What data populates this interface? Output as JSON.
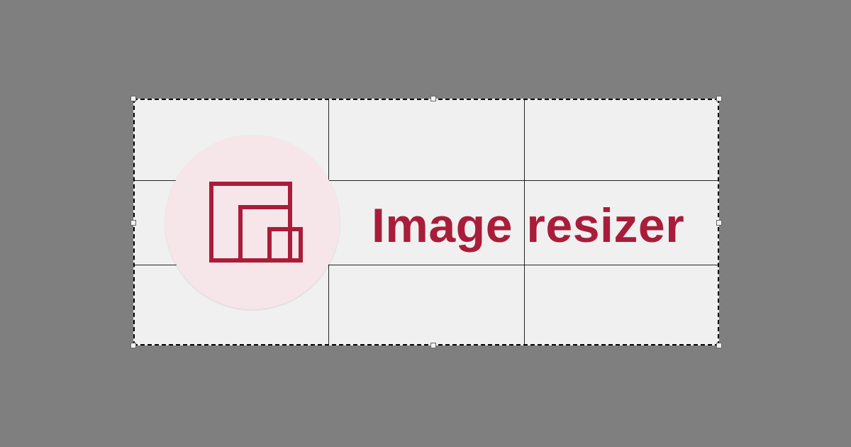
{
  "app": {
    "title": "Image resizer",
    "icon": "image-resize-icon"
  },
  "colors": {
    "background": "#7f7f7f",
    "canvas": "#f0f0f0",
    "accent": "#a91d3a",
    "logo_circle": "#f6e6e9",
    "crop_border": "#000000"
  },
  "crop": {
    "grid": "rule-of-thirds",
    "handles": 8
  }
}
